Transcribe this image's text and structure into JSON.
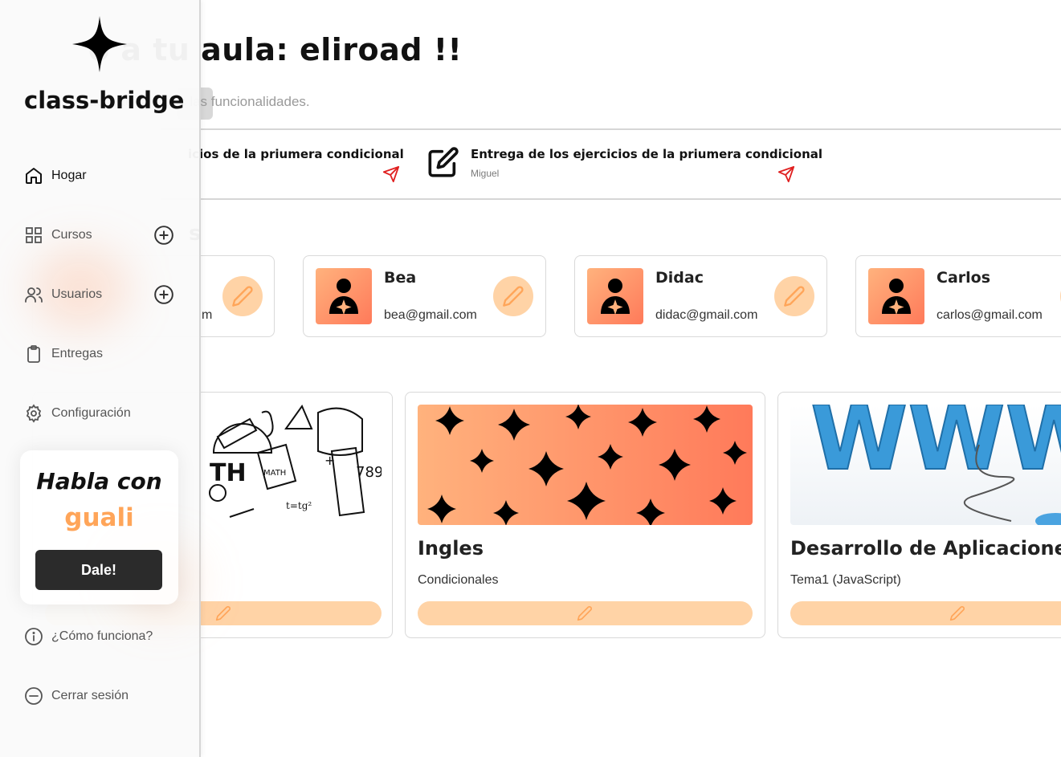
{
  "welcome": {
    "title": "o a tu aula: eliroad !!",
    "subtitle": "ula y acceder a todas las funcionalidades."
  },
  "tasks": [
    {
      "title": "icios de la priumera condicional",
      "author": ""
    },
    {
      "title": "Entrega de los ejercicios de la priumera condicional",
      "author": "Miguel"
    }
  ],
  "users_section": {
    "title_fragment": "s"
  },
  "users": [
    {
      "name": "",
      "email": "m"
    },
    {
      "name": "Bea",
      "email": "bea@gmail.com"
    },
    {
      "name": "Didac",
      "email": "didac@gmail.com"
    },
    {
      "name": "Carlos",
      "email": "carlos@gmail.com"
    }
  ],
  "courses": [
    {
      "name": "",
      "topic": "",
      "image": "math-doodles"
    },
    {
      "name": "Ingles",
      "topic": "Condicionales",
      "image": "orange-stars"
    },
    {
      "name": "Desarrollo de Aplicaciones W",
      "topic": "Tema1 (JavaScript)",
      "image": "www-letters"
    }
  ],
  "sidebar": {
    "brand": "class-bridge",
    "nav": [
      {
        "label": "Hogar",
        "icon": "home-icon",
        "active": true
      },
      {
        "label": "Cursos",
        "icon": "grid-icon",
        "has_add": true
      },
      {
        "label": "Usuarios",
        "icon": "users-icon",
        "has_add": true
      },
      {
        "label": "Entregas",
        "icon": "clipboard-icon"
      },
      {
        "label": "Configuración",
        "icon": "gear-icon"
      }
    ],
    "chat": {
      "title": "Habla con",
      "name": "guali",
      "button": "Dale!"
    },
    "footer": [
      {
        "label": "¿Cómo funciona?",
        "icon": "info-icon"
      },
      {
        "label": "Cerrar sesión",
        "icon": "logout-icon"
      }
    ]
  },
  "colors": {
    "accent_orange": "#ffa559",
    "peach_light": "#ffd3a6",
    "gradient_start": "#ffb27d",
    "gradient_end": "#ff7a5a",
    "send_icon_red": "#e02020",
    "button_dark": "#2b2b2b"
  }
}
